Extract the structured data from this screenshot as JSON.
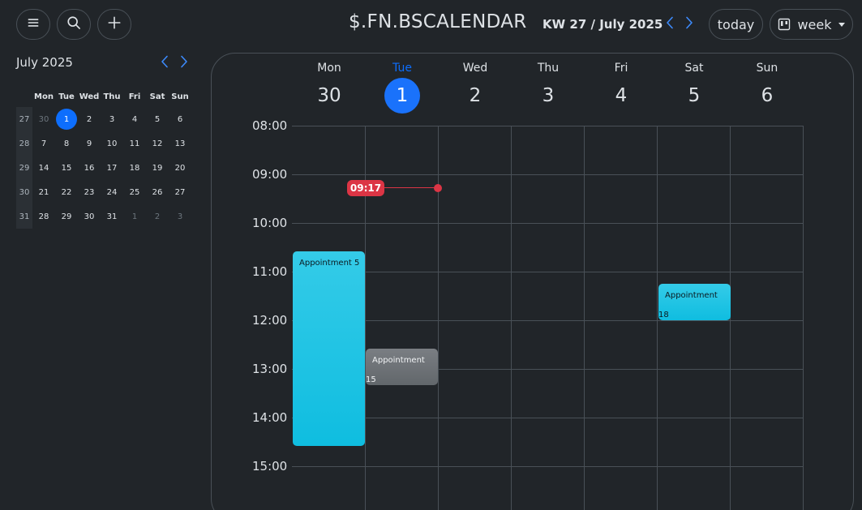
{
  "header": {
    "app_title": "$.FN.BSCALENDAR",
    "period_label": "KW 27 / July 2025",
    "today_label": "today",
    "view_label": "week"
  },
  "icons": {
    "menu": "hamburger-menu-icon",
    "search": "search-icon",
    "add": "plus-icon",
    "prev": "chevron-left-icon",
    "next": "chevron-right-icon",
    "view": "calendar-columns-icon",
    "caret": "caret-down-icon"
  },
  "colors": {
    "background": "#212529",
    "accent": "#0d6efd",
    "now_indicator": "#dc3545",
    "event_info": "#1fc3e4",
    "event_secondary": "#6c757d"
  },
  "mini_calendar": {
    "title": "July 2025",
    "weekday_headers": [
      "Mon",
      "Tue",
      "Wed",
      "Thu",
      "Fri",
      "Sat",
      "Sun"
    ],
    "weeks": [
      {
        "week": "27",
        "days": [
          {
            "d": "30",
            "muted": true
          },
          {
            "d": "1",
            "today": true
          },
          {
            "d": "2"
          },
          {
            "d": "3"
          },
          {
            "d": "4"
          },
          {
            "d": "5"
          },
          {
            "d": "6"
          }
        ]
      },
      {
        "week": "28",
        "days": [
          {
            "d": "7"
          },
          {
            "d": "8"
          },
          {
            "d": "9"
          },
          {
            "d": "10"
          },
          {
            "d": "11"
          },
          {
            "d": "12"
          },
          {
            "d": "13"
          }
        ]
      },
      {
        "week": "29",
        "days": [
          {
            "d": "14"
          },
          {
            "d": "15"
          },
          {
            "d": "16"
          },
          {
            "d": "17"
          },
          {
            "d": "18"
          },
          {
            "d": "19"
          },
          {
            "d": "20"
          }
        ]
      },
      {
        "week": "30",
        "days": [
          {
            "d": "21"
          },
          {
            "d": "22"
          },
          {
            "d": "23"
          },
          {
            "d": "24"
          },
          {
            "d": "25"
          },
          {
            "d": "26"
          },
          {
            "d": "27"
          }
        ]
      },
      {
        "week": "31",
        "days": [
          {
            "d": "28"
          },
          {
            "d": "29"
          },
          {
            "d": "30"
          },
          {
            "d": "31"
          },
          {
            "d": "1",
            "muted": true
          },
          {
            "d": "2",
            "muted": true
          },
          {
            "d": "3",
            "muted": true
          }
        ]
      }
    ]
  },
  "week_view": {
    "days": [
      {
        "name": "Mon",
        "date": "30"
      },
      {
        "name": "Tue",
        "date": "1",
        "today": true
      },
      {
        "name": "Wed",
        "date": "2"
      },
      {
        "name": "Thu",
        "date": "3"
      },
      {
        "name": "Fri",
        "date": "4"
      },
      {
        "name": "Sat",
        "date": "5"
      },
      {
        "name": "Sun",
        "date": "6"
      }
    ],
    "hours": [
      "08:00",
      "09:00",
      "10:00",
      "11:00",
      "12:00",
      "13:00",
      "14:00",
      "15:00"
    ],
    "now_label": "09:17",
    "events": [
      {
        "id": "ev-5",
        "title": "Appointment 5",
        "number": ""
      },
      {
        "id": "ev-15",
        "title": "Appointment",
        "number": "15"
      },
      {
        "id": "ev-18",
        "title": "Appointment",
        "number": "18"
      }
    ]
  }
}
